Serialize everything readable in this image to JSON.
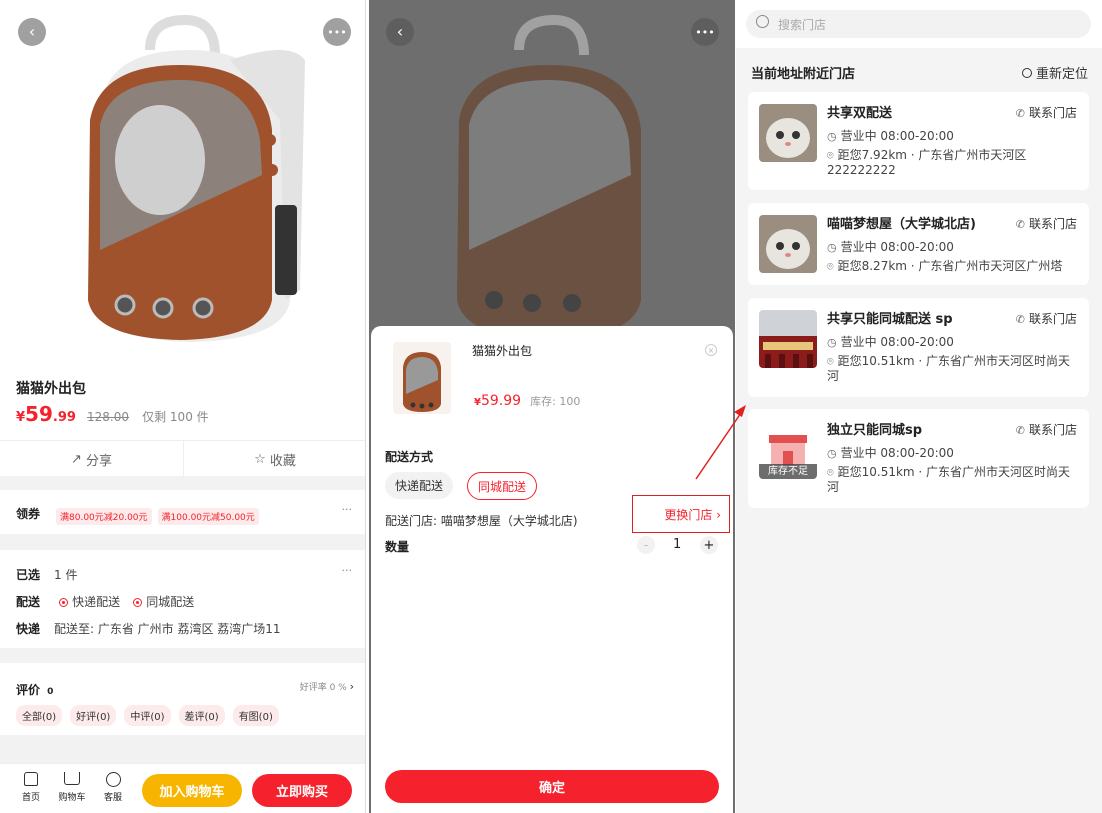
{
  "product": {
    "name": "猫猫外出包",
    "currency": "¥",
    "price_int": "59",
    "price_dec": ".99",
    "original_price": "128.00",
    "stock_left": "仅剩 100 件",
    "share": "分享",
    "favorite": "收藏"
  },
  "coupons": {
    "label": "领券",
    "items": [
      "满80.00元减20.00元",
      "满100.00元减50.00元"
    ],
    "more": "···"
  },
  "selection": {
    "selected_label": "已选",
    "selected_value": "1 件",
    "delivery_label": "配送",
    "delivery_options": [
      "快递配送",
      "同城配送"
    ],
    "express_label": "快递",
    "express_value": "配送至: 广东省 广州市 荔湾区 荔湾广场11",
    "more": "···"
  },
  "reviews": {
    "label": "评价",
    "count": "0",
    "rate": "好评率 0 %",
    "tags": [
      "全部(0)",
      "好评(0)",
      "中评(0)",
      "差评(0)",
      "有图(0)"
    ]
  },
  "bottom_bar": {
    "home": "首页",
    "cart": "购物车",
    "service": "客服",
    "add_to_cart": "加入购物车",
    "buy_now": "立即购买"
  },
  "sheet": {
    "product_name": "猫猫外出包",
    "currency": "¥",
    "price": "59.99",
    "stock": "库存: 100",
    "delivery_title": "配送方式",
    "delivery_options": [
      "快递配送",
      "同城配送"
    ],
    "store_label": "配送门店: 喵喵梦想屋（大学城北店)",
    "change_store": "更换门店 ›",
    "quantity_label": "数量",
    "quantity": "1",
    "minus": "-",
    "plus": "+",
    "confirm": "确定"
  },
  "store_picker": {
    "search_placeholder": "搜索门店",
    "nearby_title": "当前地址附近门店",
    "relocate": "重新定位",
    "call_label": "联系门店",
    "stores": [
      {
        "name": "共享双配送",
        "hours": "营业中 08:00-20:00",
        "distance": "距您7.92km · 广东省广州市天河区",
        "address_extra": "222222222"
      },
      {
        "name": "喵喵梦想屋（大学城北店)",
        "hours": "营业中 08:00-20:00",
        "distance": "距您8.27km · 广东省广州市天河区广州塔",
        "address_extra": ""
      },
      {
        "name": "共享只能同城配送 sp",
        "hours": "营业中 08:00-20:00",
        "distance": "距您10.51km · 广东省广州市天河区时尚天",
        "address_extra": "河"
      },
      {
        "name": "独立只能同城sp",
        "hours": "营业中 08:00-20:00",
        "distance": "距您10.51km · 广东省广州市天河区时尚天",
        "address_extra": "河",
        "badge": "库存不足"
      }
    ]
  },
  "colors": {
    "accent_red": "#f5222d",
    "accent_yellow": "#f7b500"
  }
}
